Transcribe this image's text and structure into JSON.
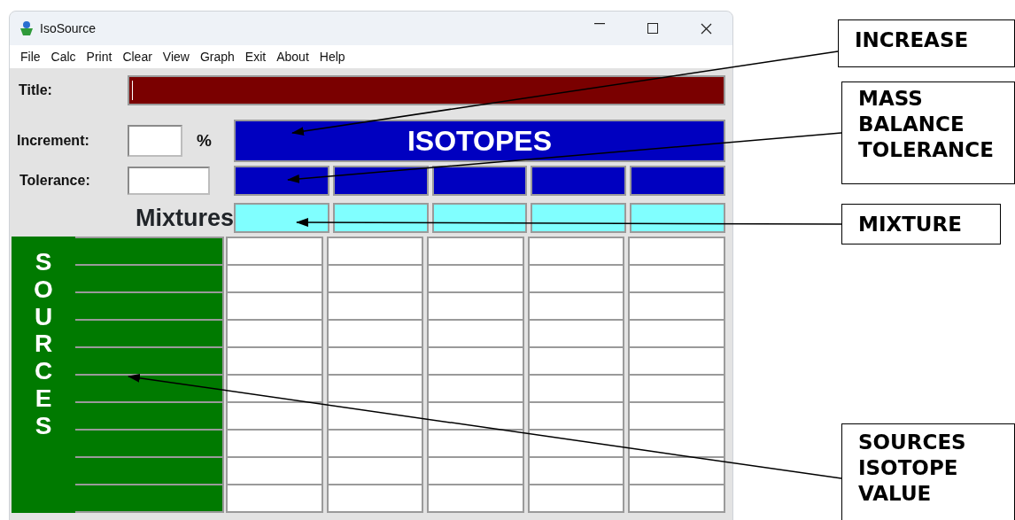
{
  "window": {
    "title": "IsoSource"
  },
  "menu": [
    "File",
    "Calc",
    "Print",
    "Clear",
    "View",
    "Graph",
    "Exit",
    "About",
    "Help"
  ],
  "form": {
    "title_label": "Title:",
    "increment_label": "Increment:",
    "increment_unit": "%",
    "tolerance_label": "Tolerance:"
  },
  "isotopes_header": "ISOTOPES",
  "mixtures_label": "Mixtures",
  "sources_label": "SOURCES",
  "annotations": [
    {
      "text": "INCREASE"
    },
    {
      "text": "MASS BALANCE TOLERANCE"
    },
    {
      "text": "MIXTURE"
    },
    {
      "text": "SOURCES ISOTOPE VALUE"
    }
  ]
}
